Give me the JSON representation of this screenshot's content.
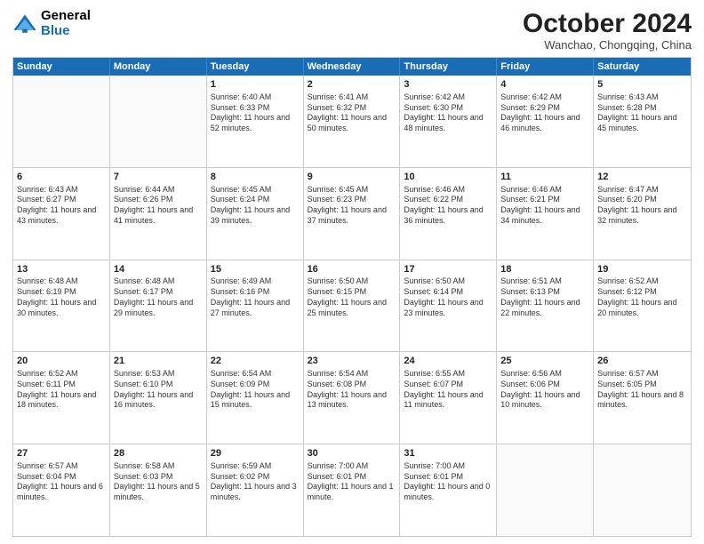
{
  "header": {
    "logo_general": "General",
    "logo_blue": "Blue",
    "month_title": "October 2024",
    "location": "Wanchao, Chongqing, China"
  },
  "days_of_week": [
    "Sunday",
    "Monday",
    "Tuesday",
    "Wednesday",
    "Thursday",
    "Friday",
    "Saturday"
  ],
  "weeks": [
    [
      {
        "day": "",
        "info": "",
        "empty": true
      },
      {
        "day": "",
        "info": "",
        "empty": true
      },
      {
        "day": "1",
        "info": "Sunrise: 6:40 AM\nSunset: 6:33 PM\nDaylight: 11 hours and 52 minutes."
      },
      {
        "day": "2",
        "info": "Sunrise: 6:41 AM\nSunset: 6:32 PM\nDaylight: 11 hours and 50 minutes."
      },
      {
        "day": "3",
        "info": "Sunrise: 6:42 AM\nSunset: 6:30 PM\nDaylight: 11 hours and 48 minutes."
      },
      {
        "day": "4",
        "info": "Sunrise: 6:42 AM\nSunset: 6:29 PM\nDaylight: 11 hours and 46 minutes."
      },
      {
        "day": "5",
        "info": "Sunrise: 6:43 AM\nSunset: 6:28 PM\nDaylight: 11 hours and 45 minutes."
      }
    ],
    [
      {
        "day": "6",
        "info": "Sunrise: 6:43 AM\nSunset: 6:27 PM\nDaylight: 11 hours and 43 minutes."
      },
      {
        "day": "7",
        "info": "Sunrise: 6:44 AM\nSunset: 6:26 PM\nDaylight: 11 hours and 41 minutes."
      },
      {
        "day": "8",
        "info": "Sunrise: 6:45 AM\nSunset: 6:24 PM\nDaylight: 11 hours and 39 minutes."
      },
      {
        "day": "9",
        "info": "Sunrise: 6:45 AM\nSunset: 6:23 PM\nDaylight: 11 hours and 37 minutes."
      },
      {
        "day": "10",
        "info": "Sunrise: 6:46 AM\nSunset: 6:22 PM\nDaylight: 11 hours and 36 minutes."
      },
      {
        "day": "11",
        "info": "Sunrise: 6:46 AM\nSunset: 6:21 PM\nDaylight: 11 hours and 34 minutes."
      },
      {
        "day": "12",
        "info": "Sunrise: 6:47 AM\nSunset: 6:20 PM\nDaylight: 11 hours and 32 minutes."
      }
    ],
    [
      {
        "day": "13",
        "info": "Sunrise: 6:48 AM\nSunset: 6:19 PM\nDaylight: 11 hours and 30 minutes."
      },
      {
        "day": "14",
        "info": "Sunrise: 6:48 AM\nSunset: 6:17 PM\nDaylight: 11 hours and 29 minutes."
      },
      {
        "day": "15",
        "info": "Sunrise: 6:49 AM\nSunset: 6:16 PM\nDaylight: 11 hours and 27 minutes."
      },
      {
        "day": "16",
        "info": "Sunrise: 6:50 AM\nSunset: 6:15 PM\nDaylight: 11 hours and 25 minutes."
      },
      {
        "day": "17",
        "info": "Sunrise: 6:50 AM\nSunset: 6:14 PM\nDaylight: 11 hours and 23 minutes."
      },
      {
        "day": "18",
        "info": "Sunrise: 6:51 AM\nSunset: 6:13 PM\nDaylight: 11 hours and 22 minutes."
      },
      {
        "day": "19",
        "info": "Sunrise: 6:52 AM\nSunset: 6:12 PM\nDaylight: 11 hours and 20 minutes."
      }
    ],
    [
      {
        "day": "20",
        "info": "Sunrise: 6:52 AM\nSunset: 6:11 PM\nDaylight: 11 hours and 18 minutes."
      },
      {
        "day": "21",
        "info": "Sunrise: 6:53 AM\nSunset: 6:10 PM\nDaylight: 11 hours and 16 minutes."
      },
      {
        "day": "22",
        "info": "Sunrise: 6:54 AM\nSunset: 6:09 PM\nDaylight: 11 hours and 15 minutes."
      },
      {
        "day": "23",
        "info": "Sunrise: 6:54 AM\nSunset: 6:08 PM\nDaylight: 11 hours and 13 minutes."
      },
      {
        "day": "24",
        "info": "Sunrise: 6:55 AM\nSunset: 6:07 PM\nDaylight: 11 hours and 11 minutes."
      },
      {
        "day": "25",
        "info": "Sunrise: 6:56 AM\nSunset: 6:06 PM\nDaylight: 11 hours and 10 minutes."
      },
      {
        "day": "26",
        "info": "Sunrise: 6:57 AM\nSunset: 6:05 PM\nDaylight: 11 hours and 8 minutes."
      }
    ],
    [
      {
        "day": "27",
        "info": "Sunrise: 6:57 AM\nSunset: 6:04 PM\nDaylight: 11 hours and 6 minutes."
      },
      {
        "day": "28",
        "info": "Sunrise: 6:58 AM\nSunset: 6:03 PM\nDaylight: 11 hours and 5 minutes."
      },
      {
        "day": "29",
        "info": "Sunrise: 6:59 AM\nSunset: 6:02 PM\nDaylight: 11 hours and 3 minutes."
      },
      {
        "day": "30",
        "info": "Sunrise: 7:00 AM\nSunset: 6:01 PM\nDaylight: 11 hours and 1 minute."
      },
      {
        "day": "31",
        "info": "Sunrise: 7:00 AM\nSunset: 6:01 PM\nDaylight: 11 hours and 0 minutes."
      },
      {
        "day": "",
        "info": "",
        "empty": true
      },
      {
        "day": "",
        "info": "",
        "empty": true
      }
    ]
  ]
}
